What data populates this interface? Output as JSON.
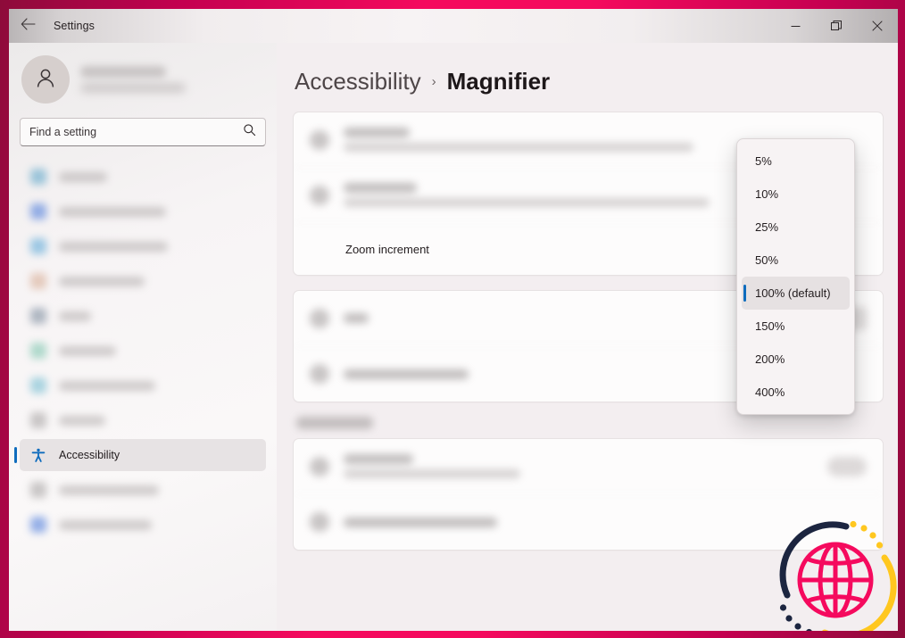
{
  "window": {
    "title": "Settings",
    "back_icon": "arrow-left-icon",
    "controls": [
      {
        "name": "minimize-button",
        "icon": "minimize-icon"
      },
      {
        "name": "restore-button",
        "icon": "restore-icon"
      },
      {
        "name": "close-button",
        "icon": "close-icon"
      }
    ]
  },
  "sidebar": {
    "account": {
      "avatar_icon": "person-icon",
      "name_placeholder": "",
      "email_placeholder": ""
    },
    "search": {
      "placeholder": "Find a setting",
      "value": "",
      "icon": "search-icon"
    },
    "items": [
      {
        "label": "",
        "icon": "system-icon",
        "active": false,
        "blurred": true,
        "width": 54,
        "color": "#4b9cc4"
      },
      {
        "label": "",
        "icon": "bluetooth-icon",
        "active": false,
        "blurred": true,
        "width": 120,
        "color": "#3a6fd8"
      },
      {
        "label": "",
        "icon": "network-icon",
        "active": false,
        "blurred": true,
        "width": 122,
        "color": "#4aa0d5"
      },
      {
        "label": "",
        "icon": "personalize-icon",
        "active": false,
        "blurred": true,
        "width": 96,
        "color": "#d3a58a"
      },
      {
        "label": "",
        "icon": "apps-icon",
        "active": false,
        "blurred": true,
        "width": 36,
        "color": "#6d7f93"
      },
      {
        "label": "",
        "icon": "accounts-icon",
        "active": false,
        "blurred": true,
        "width": 64,
        "color": "#6fc0a6"
      },
      {
        "label": "",
        "icon": "time-language-icon",
        "active": false,
        "blurred": true,
        "width": 108,
        "color": "#62b4cb"
      },
      {
        "label": "",
        "icon": "gaming-icon",
        "active": false,
        "blurred": true,
        "width": 52,
        "color": "#9e9a9a"
      },
      {
        "label": "Accessibility",
        "icon": "accessibility-icon",
        "active": true,
        "blurred": false,
        "width": 0,
        "color": "#0f6cbd"
      },
      {
        "label": "",
        "icon": "privacy-icon",
        "active": false,
        "blurred": true,
        "width": 112,
        "color": "#9e9a9a"
      },
      {
        "label": "",
        "icon": "windows-update-icon",
        "active": false,
        "blurred": true,
        "width": 104,
        "color": "#3a6fd8"
      }
    ]
  },
  "main": {
    "breadcrumb": {
      "parent": "Accessibility",
      "separator": "›",
      "current": "Magnifier"
    },
    "cards": [
      {
        "name": "magnifier-card",
        "rows": [
          {
            "name": "table-row",
            "blurred": true,
            "icon": true,
            "title_w": 74,
            "sub_w": 392,
            "trail": "none"
          },
          {
            "name": "table-row",
            "blurred": true,
            "icon": true,
            "title_w": 82,
            "sub_w": 410,
            "trail": "none"
          }
        ],
        "zoom_increment_label": "Zoom increment"
      },
      {
        "name": "view-card",
        "rows": [
          {
            "name": "table-row",
            "blurred": true,
            "icon": true,
            "title_w": 28,
            "sub_w": 0,
            "trail": "combo"
          },
          {
            "name": "table-row",
            "blurred": true,
            "icon": true,
            "title_w": 140,
            "sub_w": 0,
            "trail": "none"
          }
        ]
      }
    ],
    "section_header_blurred": true,
    "related_card": {
      "name": "related-settings-card",
      "rows": [
        {
          "name": "table-row",
          "blurred": true,
          "icon": true,
          "title_w": 78,
          "sub_w": 198,
          "trail": "toggle"
        },
        {
          "name": "table-row",
          "blurred": true,
          "icon": true,
          "title_w": 172,
          "sub_w": 0,
          "trail": "none"
        }
      ]
    }
  },
  "dropdown": {
    "name": "zoom-increment-dropdown",
    "options": [
      {
        "label": "5%",
        "selected": false
      },
      {
        "label": "10%",
        "selected": false
      },
      {
        "label": "25%",
        "selected": false
      },
      {
        "label": "50%",
        "selected": false
      },
      {
        "label": "100% (default)",
        "selected": true
      },
      {
        "label": "150%",
        "selected": false
      },
      {
        "label": "200%",
        "selected": false
      },
      {
        "label": "400%",
        "selected": false
      }
    ]
  },
  "watermark": {
    "name": "globe-logo",
    "icon": "globe-icon"
  },
  "colors": {
    "frame_pink": "#f50a5e",
    "frame_dark": "#8d0b3a",
    "accent_blue": "#0f6cbd",
    "globe_pink": "#f50a5e",
    "globe_navy": "#1c2540",
    "globe_yellow": "#ffc71f"
  }
}
